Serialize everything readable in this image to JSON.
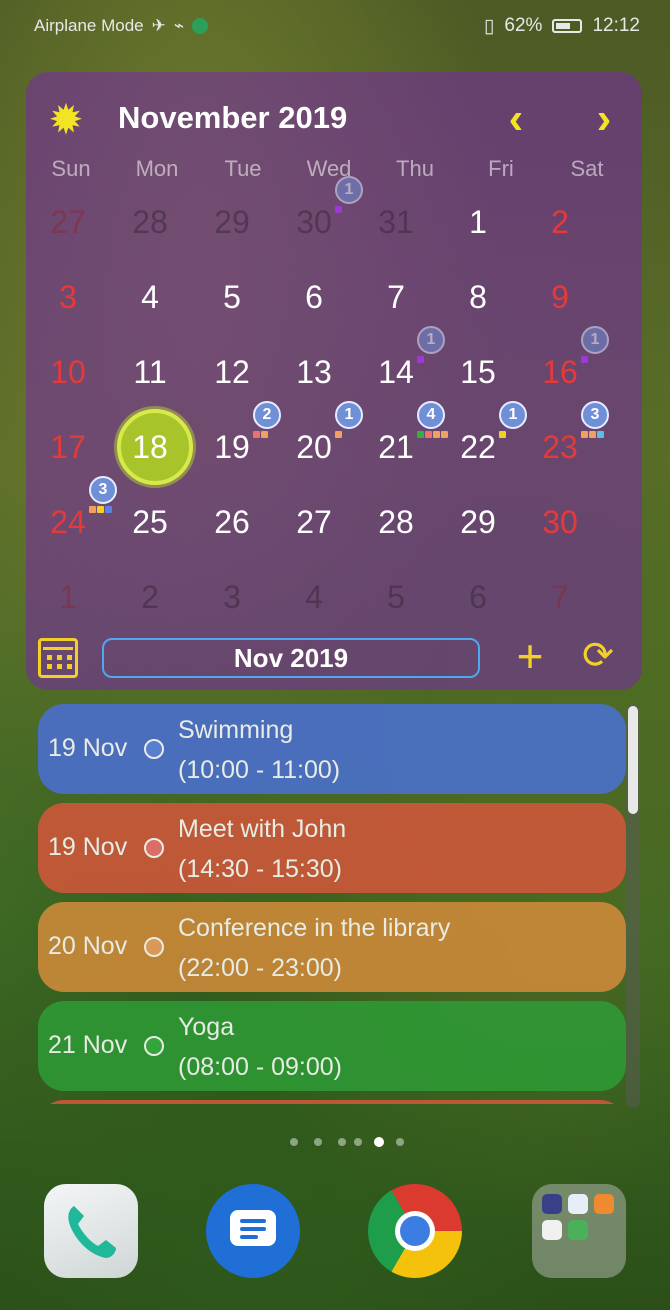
{
  "status_bar": {
    "left_text": "Airplane Mode",
    "battery": "62%",
    "time": "12:12"
  },
  "widget": {
    "month_title": "November 2019",
    "weekdays": [
      "Sun",
      "Mon",
      "Tue",
      "Wed",
      "Thu",
      "Fri",
      "Sat"
    ],
    "range_label": "Nov 2019",
    "accent_color": "#f2e425",
    "today": "18",
    "days": [
      {
        "n": "27"
      },
      {
        "n": "28"
      },
      {
        "n": "29"
      },
      {
        "n": "30",
        "badge": "1"
      },
      {
        "n": "31"
      },
      {
        "n": "1"
      },
      {
        "n": "2"
      },
      {
        "n": "3"
      },
      {
        "n": "4"
      },
      {
        "n": "5"
      },
      {
        "n": "6"
      },
      {
        "n": "7"
      },
      {
        "n": "8"
      },
      {
        "n": "9"
      },
      {
        "n": "10"
      },
      {
        "n": "11"
      },
      {
        "n": "12"
      },
      {
        "n": "13"
      },
      {
        "n": "14",
        "badge": "1"
      },
      {
        "n": "15"
      },
      {
        "n": "16",
        "badge": "1"
      },
      {
        "n": "17"
      },
      {
        "n": "18"
      },
      {
        "n": "19",
        "badge": "2"
      },
      {
        "n": "20",
        "badge": "1"
      },
      {
        "n": "21",
        "badge": "4"
      },
      {
        "n": "22",
        "badge": "1"
      },
      {
        "n": "23",
        "badge": "3"
      },
      {
        "n": "24",
        "badge": "3"
      },
      {
        "n": "25"
      },
      {
        "n": "26"
      },
      {
        "n": "27"
      },
      {
        "n": "28"
      },
      {
        "n": "29"
      },
      {
        "n": "30"
      },
      {
        "n": "1"
      },
      {
        "n": "2"
      },
      {
        "n": "3"
      },
      {
        "n": "4"
      },
      {
        "n": "5"
      },
      {
        "n": "6"
      },
      {
        "n": "7"
      }
    ]
  },
  "events": [
    {
      "date": "19 Nov",
      "title": "Swimming",
      "time": "(10:00 - 11:00)",
      "color": "#4a6fd0",
      "dot": "#5b82e8"
    },
    {
      "date": "19 Nov",
      "title": "Meet with John",
      "time": "(14:30 - 15:30)",
      "color": "#d0573a",
      "dot": "#f07070"
    },
    {
      "date": "20 Nov",
      "title": "Conference in the library",
      "time": "(22:00 - 23:00)",
      "color": "#d08a3a",
      "dot": "#f2a060"
    },
    {
      "date": "21 Nov",
      "title": "Yoga",
      "time": "(08:00 - 09:00)",
      "color": "#2f9a35",
      "dot": "#35b040"
    }
  ]
}
